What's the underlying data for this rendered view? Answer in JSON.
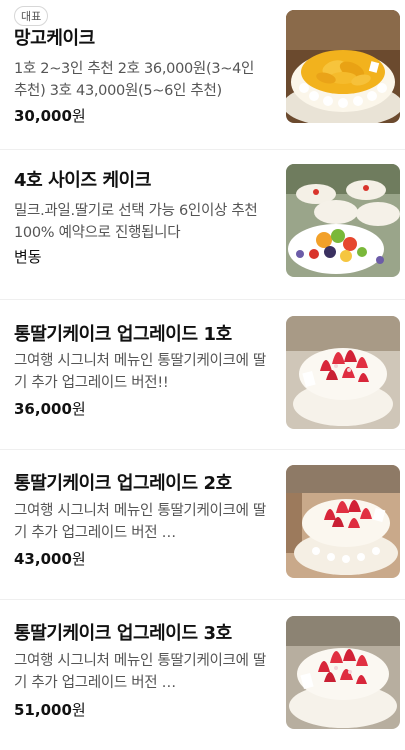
{
  "items": [
    {
      "badge": "대표",
      "title": "망고케이크",
      "desc": "1호 2~3인 추천 2호 36,000원(3~4인 추천) 3호 43,000원(5~6인 추천)",
      "price_value": "30,000",
      "price_unit": "원",
      "image_icon": "mango-cake-photo"
    },
    {
      "title": "4호 사이즈 케이크",
      "desc": "밀크.과일.딸기로 선택 가능 6인이상 추천 100% 예약으로 진행됩니다",
      "price_text": "변동",
      "image_icon": "fruit-cakes-photo"
    },
    {
      "title": "통딸기케이크 업그레이드 1호",
      "desc": "그여행 시그니처 메뉴인 통딸기케이크에 딸기 추가 업그레이드 버전!!",
      "price_value": "36,000",
      "price_unit": "원",
      "image_icon": "strawberry-cake-photo"
    },
    {
      "title": "통딸기케이크 업그레이드 2호",
      "desc": "그여행 시그니처 메뉴인 통딸기케이크에 딸기 추가 업그레이드 버전 …",
      "price_value": "43,000",
      "price_unit": "원",
      "image_icon": "strawberry-cake-photo"
    },
    {
      "title": "통딸기케이크 업그레이드 3호",
      "desc": "그여행 시그니처 메뉴인 통딸기케이크에 딸기 추가 업그레이드 버전 …",
      "price_value": "51,000",
      "price_unit": "원",
      "image_icon": "strawberry-cake-photo"
    }
  ],
  "colors": {
    "title": "#111111",
    "desc": "#555555",
    "divider": "#efefef",
    "badge_border": "#d7d7d7"
  }
}
